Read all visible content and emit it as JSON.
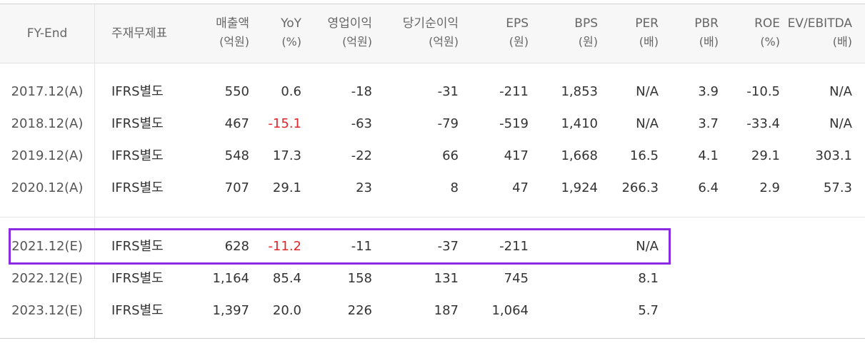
{
  "columns": [
    {
      "key": "period",
      "l1": "FY-End",
      "l2": ""
    },
    {
      "key": "basis",
      "l1": "주재무제표",
      "l2": ""
    },
    {
      "key": "revenue",
      "l1": "매출액",
      "l2": "(억원)"
    },
    {
      "key": "yoy",
      "l1": "YoY",
      "l2": "(%)"
    },
    {
      "key": "op_income",
      "l1": "영업이익",
      "l2": "(억원)"
    },
    {
      "key": "net_income",
      "l1": "당기순이익",
      "l2": "(억원)"
    },
    {
      "key": "eps",
      "l1": "EPS",
      "l2": "(원)"
    },
    {
      "key": "bps",
      "l1": "BPS",
      "l2": "(원)"
    },
    {
      "key": "per",
      "l1": "PER",
      "l2": "(배)"
    },
    {
      "key": "pbr",
      "l1": "PBR",
      "l2": "(배)"
    },
    {
      "key": "roe",
      "l1": "ROE",
      "l2": "(%)"
    },
    {
      "key": "ev_ebitda",
      "l1": "EV/EBITDA",
      "l2": "(배)"
    }
  ],
  "actual_rows": [
    {
      "period": "2017.12(A)",
      "basis": "IFRS별도",
      "revenue": "550",
      "yoy": "0.6",
      "op_income": "-18",
      "net_income": "-31",
      "eps": "-211",
      "bps": "1,853",
      "per": "N/A",
      "pbr": "3.9",
      "roe": "-10.5",
      "ev_ebitda": "N/A"
    },
    {
      "period": "2018.12(A)",
      "basis": "IFRS별도",
      "revenue": "467",
      "yoy": "-15.1",
      "op_income": "-63",
      "net_income": "-79",
      "eps": "-519",
      "bps": "1,410",
      "per": "N/A",
      "pbr": "3.7",
      "roe": "-33.4",
      "ev_ebitda": "N/A"
    },
    {
      "period": "2019.12(A)",
      "basis": "IFRS별도",
      "revenue": "548",
      "yoy": "17.3",
      "op_income": "-22",
      "net_income": "66",
      "eps": "417",
      "bps": "1,668",
      "per": "16.5",
      "pbr": "4.1",
      "roe": "29.1",
      "ev_ebitda": "303.1"
    },
    {
      "period": "2020.12(A)",
      "basis": "IFRS별도",
      "revenue": "707",
      "yoy": "29.1",
      "op_income": "23",
      "net_income": "8",
      "eps": "47",
      "bps": "1,924",
      "per": "266.3",
      "pbr": "6.4",
      "roe": "2.9",
      "ev_ebitda": "57.3"
    }
  ],
  "estimate_rows": [
    {
      "period": "2021.12(E)",
      "basis": "IFRS별도",
      "revenue": "628",
      "yoy": "-11.2",
      "op_income": "-11",
      "net_income": "-37",
      "eps": "-211",
      "bps": "",
      "per": "N/A",
      "pbr": "",
      "roe": "",
      "ev_ebitda": ""
    },
    {
      "period": "2022.12(E)",
      "basis": "IFRS별도",
      "revenue": "1,164",
      "yoy": "85.4",
      "op_income": "158",
      "net_income": "131",
      "eps": "745",
      "bps": "",
      "per": "8.1",
      "pbr": "",
      "roe": "",
      "ev_ebitda": ""
    },
    {
      "period": "2023.12(E)",
      "basis": "IFRS별도",
      "revenue": "1,397",
      "yoy": "20.0",
      "op_income": "226",
      "net_income": "187",
      "eps": "1,064",
      "bps": "",
      "per": "5.7",
      "pbr": "",
      "roe": "",
      "ev_ebitda": ""
    }
  ],
  "colors": {
    "negative_yoy": "#e0262b",
    "highlight_border": "#8a2be2",
    "header_bg": "#f7f7f7"
  }
}
